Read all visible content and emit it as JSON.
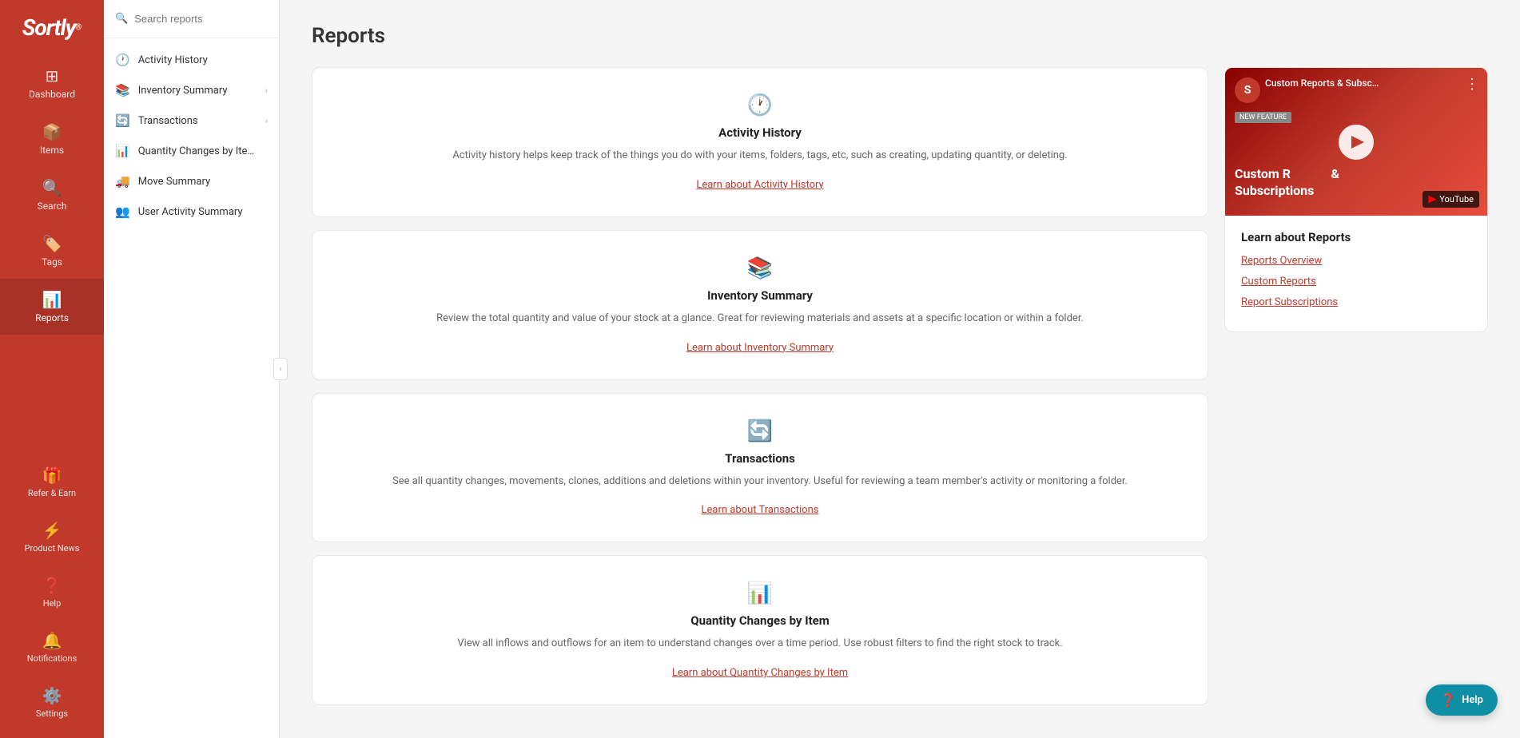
{
  "brand": {
    "name": "Sortly",
    "superscript": "®"
  },
  "sidebar": {
    "items": [
      {
        "id": "dashboard",
        "label": "Dashboard",
        "icon": "⊞"
      },
      {
        "id": "items",
        "label": "Items",
        "icon": "📦"
      },
      {
        "id": "search",
        "label": "Search",
        "icon": "🔍"
      },
      {
        "id": "tags",
        "label": "Tags",
        "icon": "🏷️"
      },
      {
        "id": "reports",
        "label": "Reports",
        "icon": "📊",
        "active": true
      }
    ],
    "bottom_items": [
      {
        "id": "refer",
        "label": "Refer & Earn",
        "icon": "🎁"
      },
      {
        "id": "product-news",
        "label": "Product News",
        "icon": "⚡",
        "badge": true
      },
      {
        "id": "help",
        "label": "Help",
        "icon": "❓"
      },
      {
        "id": "notifications",
        "label": "Notifications",
        "icon": "🔔"
      },
      {
        "id": "settings",
        "label": "Settings",
        "icon": "⚙️"
      }
    ]
  },
  "sub_sidebar": {
    "search_placeholder": "Search reports",
    "items": [
      {
        "id": "activity-history",
        "label": "Activity History",
        "icon": "🕐",
        "has_chevron": false
      },
      {
        "id": "inventory-summary",
        "label": "Inventory Summary",
        "icon": "📚",
        "has_chevron": true
      },
      {
        "id": "transactions",
        "label": "Transactions",
        "icon": "🔄",
        "has_chevron": true
      },
      {
        "id": "quantity-changes",
        "label": "Quantity Changes by Ite…",
        "icon": "📊",
        "has_chevron": false
      },
      {
        "id": "move-summary",
        "label": "Move Summary",
        "icon": "🚚",
        "has_chevron": false
      },
      {
        "id": "user-activity",
        "label": "User Activity Summary",
        "icon": "👥",
        "has_chevron": false
      }
    ]
  },
  "page": {
    "title": "Reports"
  },
  "report_cards": [
    {
      "id": "activity-history",
      "icon": "🕐",
      "title": "Activity History",
      "description": "Activity history helps keep track of the things you do with your items, folders, tags, etc, such as creating, updating quantity, or deleting.",
      "link_label": "Learn about Activity History",
      "link_url": "#"
    },
    {
      "id": "inventory-summary",
      "icon": "📚",
      "title": "Inventory Summary",
      "description": "Review the total quantity and value of your stock at a glance. Great for reviewing materials and assets at a specific location or within a folder.",
      "link_label": "Learn about Inventory Summary",
      "link_url": "#"
    },
    {
      "id": "transactions",
      "icon": "🔄",
      "title": "Transactions",
      "description": "See all quantity changes, movements, clones, additions and deletions within your inventory. Useful for reviewing a team member's activity or monitoring a folder.",
      "link_label": "Learn about Transactions",
      "link_url": "#"
    },
    {
      "id": "quantity-changes",
      "icon": "📊",
      "title": "Quantity Changes by Item",
      "description": "View all inflows and outflows for an item to understand changes over a time period. Use robust filters to find the right stock to track.",
      "link_label": "Learn about Quantity Changes by Item",
      "link_url": "#"
    }
  ],
  "side_panel": {
    "video": {
      "title": "Custom Reports & Subsc…",
      "label": "Custom Reports & Subsc…",
      "new_feature_text": "NEW FEATURE",
      "main_title_line1": "Custom R",
      "main_title_line2": "Subscriptions",
      "yt_label": "YouTube"
    },
    "learn_title": "Learn about Reports",
    "links": [
      {
        "label": "Reports Overview",
        "url": "#"
      },
      {
        "label": "Custom Reports",
        "url": "#"
      },
      {
        "label": "Report Subscriptions",
        "url": "#"
      }
    ]
  },
  "help_fab": {
    "label": "Help",
    "icon": "❓"
  }
}
